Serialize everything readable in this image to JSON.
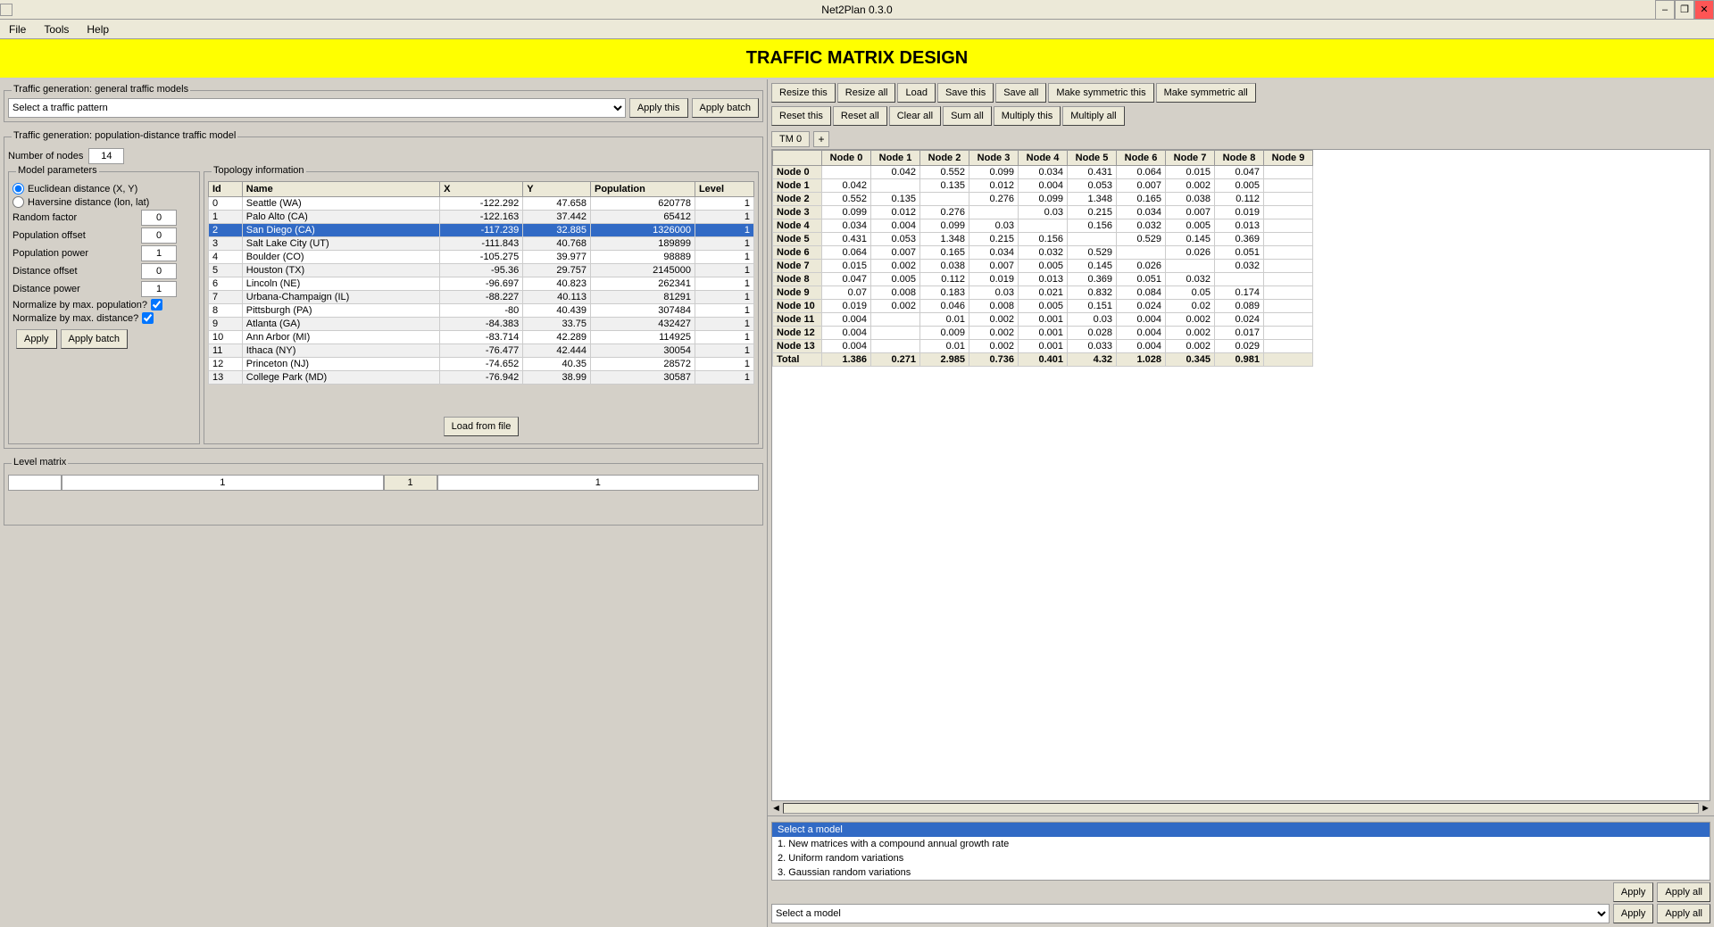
{
  "window": {
    "title": "Net2Plan 0.3.0",
    "min": "–",
    "restore": "❐",
    "close": "✕"
  },
  "menu": {
    "items": [
      "File",
      "Tools",
      "Help"
    ]
  },
  "header": {
    "title": "TRAFFIC MATRIX DESIGN"
  },
  "left": {
    "traffic_general": {
      "section_title": "Traffic generation: general traffic models",
      "dropdown_placeholder": "Select a traffic pattern",
      "apply_this": "Apply this",
      "apply_batch": "Apply batch"
    },
    "pop_distance": {
      "section_title": "Traffic generation: population-distance traffic model",
      "num_nodes_label": "Number of nodes",
      "num_nodes_value": "14"
    },
    "model_params": {
      "section_title": "Model parameters",
      "euclidean_label": "Euclidean distance (X, Y)",
      "haversine_label": "Haversine distance (lon, lat)",
      "params": [
        {
          "label": "Random factor",
          "value": "0"
        },
        {
          "label": "Population offset",
          "value": "0"
        },
        {
          "label": "Population power",
          "value": "1"
        },
        {
          "label": "Distance offset",
          "value": "0"
        },
        {
          "label": "Distance power",
          "value": "1"
        }
      ],
      "normalize_pop": "Normalize by max. population?",
      "normalize_pop_checked": true,
      "normalize_dist": "Normalize by max. distance?",
      "normalize_dist_checked": true,
      "apply_btn": "Apply",
      "apply_batch_btn": "Apply batch"
    },
    "topology": {
      "section_title": "Topology information",
      "columns": [
        "Id",
        "Name",
        "X",
        "Y",
        "Population",
        "Level"
      ],
      "rows": [
        {
          "id": 0,
          "name": "Seattle (WA)",
          "x": "-122.292",
          "y": "47.658",
          "pop": "620778",
          "level": "1"
        },
        {
          "id": 1,
          "name": "Palo Alto (CA)",
          "x": "-122.163",
          "y": "37.442",
          "pop": "65412",
          "level": "1"
        },
        {
          "id": 2,
          "name": "San Diego (CA)",
          "x": "-117.239",
          "y": "32.885",
          "pop": "1326000",
          "level": "1"
        },
        {
          "id": 3,
          "name": "Salt Lake City (UT)",
          "x": "-111.843",
          "y": "40.768",
          "pop": "189899",
          "level": "1"
        },
        {
          "id": 4,
          "name": "Boulder (CO)",
          "x": "-105.275",
          "y": "39.977",
          "pop": "98889",
          "level": "1"
        },
        {
          "id": 5,
          "name": "Houston (TX)",
          "x": "-95.36",
          "y": "29.757",
          "pop": "2145000",
          "level": "1"
        },
        {
          "id": 6,
          "name": "Lincoln (NE)",
          "x": "-96.697",
          "y": "40.823",
          "pop": "262341",
          "level": "1"
        },
        {
          "id": 7,
          "name": "Urbana-Champaign (IL)",
          "x": "-88.227",
          "y": "40.113",
          "pop": "81291",
          "level": "1"
        },
        {
          "id": 8,
          "name": "Pittsburgh (PA)",
          "x": "-80",
          "y": "40.439",
          "pop": "307484",
          "level": "1"
        },
        {
          "id": 9,
          "name": "Atlanta (GA)",
          "x": "-84.383",
          "y": "33.75",
          "pop": "432427",
          "level": "1"
        },
        {
          "id": 10,
          "name": "Ann Arbor (MI)",
          "x": "-83.714",
          "y": "42.289",
          "pop": "114925",
          "level": "1"
        },
        {
          "id": 11,
          "name": "Ithaca (NY)",
          "x": "-76.477",
          "y": "42.444",
          "pop": "30054",
          "level": "1"
        },
        {
          "id": 12,
          "name": "Princeton (NJ)",
          "x": "-74.652",
          "y": "40.35",
          "pop": "28572",
          "level": "1"
        },
        {
          "id": 13,
          "name": "College Park (MD)",
          "x": "-76.942",
          "y": "38.99",
          "pop": "30587",
          "level": "1"
        }
      ],
      "load_from_file": "Load from file"
    },
    "level_matrix": {
      "section_title": "Level matrix",
      "cell1": "1",
      "cell2": "1"
    }
  },
  "right": {
    "toolbar": {
      "resize_this": "Resize this",
      "resize_all": "Resize all",
      "load": "Load",
      "save_this": "Save this",
      "save_all": "Save all",
      "make_symmetric_this": "Make symmetric this",
      "make_symmetric_all": "Make symmetric all",
      "reset_this": "Reset this",
      "reset_all": "Reset all",
      "clear_all": "Clear all",
      "sum_all": "Sum all",
      "multiply_this": "Multiply this",
      "multiply_all": "Multiply all"
    },
    "tm_tab": "TM 0",
    "tm_add": "+",
    "columns": [
      "Node 0",
      "Node 1",
      "Node 2",
      "Node 3",
      "Node 4",
      "Node 5",
      "Node 6",
      "Node 7",
      "Node 8",
      "Node 9"
    ],
    "rows": [
      {
        "label": "Node 0",
        "values": [
          "",
          "0.042",
          "0.552",
          "0.099",
          "0.034",
          "0.431",
          "0.064",
          "0.015",
          "0.047",
          ""
        ]
      },
      {
        "label": "Node 1",
        "values": [
          "0.042",
          "",
          "0.135",
          "0.012",
          "0.004",
          "0.053",
          "0.007",
          "0.002",
          "0.005",
          ""
        ]
      },
      {
        "label": "Node 2",
        "values": [
          "0.552",
          "0.135",
          "",
          "0.276",
          "0.099",
          "1.348",
          "0.165",
          "0.038",
          "0.112",
          ""
        ]
      },
      {
        "label": "Node 3",
        "values": [
          "0.099",
          "0.012",
          "0.276",
          "",
          "0.03",
          "0.215",
          "0.034",
          "0.007",
          "0.019",
          ""
        ]
      },
      {
        "label": "Node 4",
        "values": [
          "0.034",
          "0.004",
          "0.099",
          "0.03",
          "",
          "0.156",
          "0.032",
          "0.005",
          "0.013",
          ""
        ]
      },
      {
        "label": "Node 5",
        "values": [
          "0.431",
          "0.053",
          "1.348",
          "0.215",
          "0.156",
          "",
          "0.529",
          "0.145",
          "0.369",
          ""
        ]
      },
      {
        "label": "Node 6",
        "values": [
          "0.064",
          "0.007",
          "0.165",
          "0.034",
          "0.032",
          "0.529",
          "",
          "0.026",
          "0.051",
          ""
        ]
      },
      {
        "label": "Node 7",
        "values": [
          "0.015",
          "0.002",
          "0.038",
          "0.007",
          "0.005",
          "0.145",
          "0.026",
          "",
          "0.032",
          ""
        ]
      },
      {
        "label": "Node 8",
        "values": [
          "0.047",
          "0.005",
          "0.112",
          "0.019",
          "0.013",
          "0.369",
          "0.051",
          "0.032",
          "",
          ""
        ]
      },
      {
        "label": "Node 9",
        "values": [
          "0.07",
          "0.008",
          "0.183",
          "0.03",
          "0.021",
          "0.832",
          "0.084",
          "0.05",
          "0.174",
          ""
        ]
      },
      {
        "label": "Node 10",
        "values": [
          "0.019",
          "0.002",
          "0.046",
          "0.008",
          "0.005",
          "0.151",
          "0.024",
          "0.02",
          "0.089",
          ""
        ]
      },
      {
        "label": "Node 11",
        "values": [
          "0.004",
          "",
          "0.01",
          "0.002",
          "0.001",
          "0.03",
          "0.004",
          "0.002",
          "0.024",
          ""
        ]
      },
      {
        "label": "Node 12",
        "values": [
          "0.004",
          "",
          "0.009",
          "0.002",
          "0.001",
          "0.028",
          "0.004",
          "0.002",
          "0.017",
          ""
        ]
      },
      {
        "label": "Node 13",
        "values": [
          "0.004",
          "",
          "0.01",
          "0.002",
          "0.001",
          "0.033",
          "0.004",
          "0.002",
          "0.029",
          ""
        ]
      },
      {
        "label": "Total",
        "values": [
          "1.386",
          "0.271",
          "2.985",
          "0.736",
          "0.401",
          "4.32",
          "1.028",
          "0.345",
          "0.981",
          ""
        ]
      }
    ],
    "bottom": {
      "model_list": [
        {
          "label": "Select a model",
          "selected": true
        },
        {
          "label": "1. New matrices with a compound annual growth rate"
        },
        {
          "label": "2. Uniform random variations"
        },
        {
          "label": "3. Gaussian random variations"
        }
      ],
      "apply_btn": "Apply",
      "apply_all_btn": "Apply all",
      "select_model_placeholder": "Select a model",
      "apply_btn2": "Apply",
      "apply_all_btn2": "Apply all"
    }
  }
}
